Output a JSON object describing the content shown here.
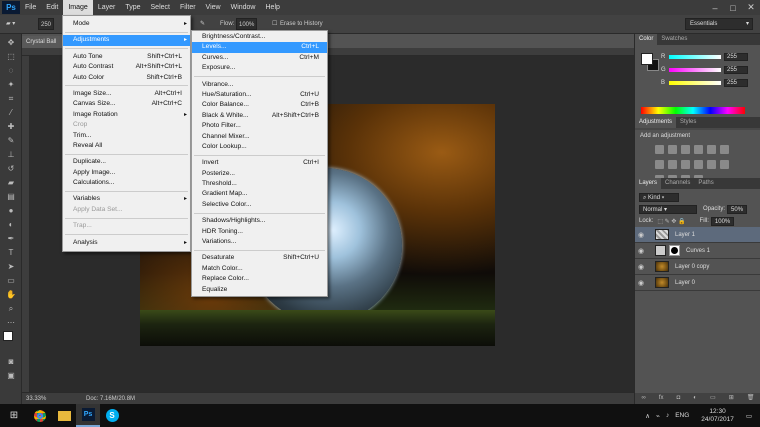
{
  "menubar": {
    "items": [
      "File",
      "Edit",
      "Image",
      "Layer",
      "Type",
      "Select",
      "Filter",
      "View",
      "Window",
      "Help"
    ],
    "active": "Image"
  },
  "options": {
    "brush_size": "250",
    "flow_label": "Flow:",
    "flow_value": "100%",
    "erase_history": "Erase to History",
    "workspace": "Essentials"
  },
  "document": {
    "tab": "Crystal Ball",
    "zoom": "33.33%",
    "doc_info": "Doc: 7.16M/20.8M"
  },
  "image_menu": {
    "items": [
      {
        "label": "Mode",
        "submenu": true
      },
      {
        "sep": true
      },
      {
        "label": "Adjustments",
        "submenu": true,
        "highlight": true
      },
      {
        "sep": true
      },
      {
        "label": "Auto Tone",
        "shortcut": "Shift+Ctrl+L"
      },
      {
        "label": "Auto Contrast",
        "shortcut": "Alt+Shift+Ctrl+L"
      },
      {
        "label": "Auto Color",
        "shortcut": "Shift+Ctrl+B"
      },
      {
        "sep": true
      },
      {
        "label": "Image Size...",
        "shortcut": "Alt+Ctrl+I"
      },
      {
        "label": "Canvas Size...",
        "shortcut": "Alt+Ctrl+C"
      },
      {
        "label": "Image Rotation",
        "submenu": true
      },
      {
        "label": "Crop",
        "disabled": true
      },
      {
        "label": "Trim..."
      },
      {
        "label": "Reveal All"
      },
      {
        "sep": true
      },
      {
        "label": "Duplicate..."
      },
      {
        "label": "Apply Image..."
      },
      {
        "label": "Calculations..."
      },
      {
        "sep": true
      },
      {
        "label": "Variables",
        "submenu": true
      },
      {
        "label": "Apply Data Set...",
        "disabled": true
      },
      {
        "sep": true
      },
      {
        "label": "Trap...",
        "disabled": true
      },
      {
        "sep": true
      },
      {
        "label": "Analysis",
        "submenu": true
      }
    ]
  },
  "adjust_menu": {
    "items": [
      {
        "label": "Brightness/Contrast..."
      },
      {
        "label": "Levels...",
        "shortcut": "Ctrl+L",
        "highlight": true
      },
      {
        "label": "Curves...",
        "shortcut": "Ctrl+M"
      },
      {
        "label": "Exposure..."
      },
      {
        "sep": true
      },
      {
        "label": "Vibrance..."
      },
      {
        "label": "Hue/Saturation...",
        "shortcut": "Ctrl+U"
      },
      {
        "label": "Color Balance...",
        "shortcut": "Ctrl+B"
      },
      {
        "label": "Black & White...",
        "shortcut": "Alt+Shift+Ctrl+B"
      },
      {
        "label": "Photo Filter..."
      },
      {
        "label": "Channel Mixer..."
      },
      {
        "label": "Color Lookup..."
      },
      {
        "sep": true
      },
      {
        "label": "Invert",
        "shortcut": "Ctrl+I"
      },
      {
        "label": "Posterize..."
      },
      {
        "label": "Threshold..."
      },
      {
        "label": "Gradient Map..."
      },
      {
        "label": "Selective Color..."
      },
      {
        "sep": true
      },
      {
        "label": "Shadows/Highlights..."
      },
      {
        "label": "HDR Toning..."
      },
      {
        "label": "Variations..."
      },
      {
        "sep": true
      },
      {
        "label": "Desaturate",
        "shortcut": "Shift+Ctrl+U"
      },
      {
        "label": "Match Color..."
      },
      {
        "label": "Replace Color..."
      },
      {
        "label": "Equalize"
      }
    ]
  },
  "color_panel": {
    "tabs": [
      "Color",
      "Swatches"
    ],
    "channels": [
      {
        "label": "R",
        "value": "255"
      },
      {
        "label": "G",
        "value": "255"
      },
      {
        "label": "B",
        "value": "255"
      }
    ]
  },
  "adjustments_panel": {
    "tabs": [
      "Adjustments",
      "Styles"
    ],
    "title": "Add an adjustment"
  },
  "layers_panel": {
    "tabs": [
      "Layers",
      "Channels",
      "Paths"
    ],
    "kind": "Kind",
    "blend": "Normal",
    "opacity_label": "Opacity:",
    "opacity": "50%",
    "lock_label": "Lock:",
    "fill_label": "Fill:",
    "fill": "100%",
    "layers": [
      {
        "name": "Layer 1",
        "selected": true,
        "type": "pattern"
      },
      {
        "name": "Curves 1",
        "type": "adjust"
      },
      {
        "name": "Layer 0 copy",
        "type": "photo"
      },
      {
        "name": "Layer 0",
        "type": "photo"
      }
    ]
  },
  "taskbar": {
    "lang": "ENG",
    "time": "12:30",
    "date": "24/07/2017"
  }
}
